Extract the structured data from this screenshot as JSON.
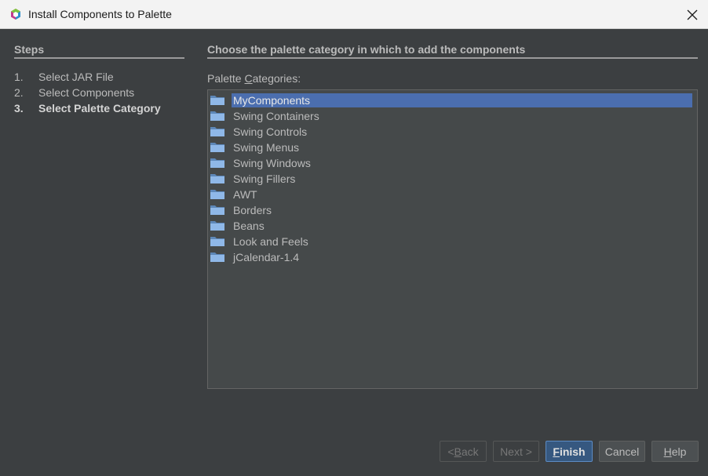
{
  "window": {
    "title": "Install Components to Palette",
    "close_icon": "close-icon",
    "app_icon": "netbeans-icon"
  },
  "steps": {
    "heading": "Steps",
    "items": [
      {
        "num": "1.",
        "label": "Select JAR File"
      },
      {
        "num": "2.",
        "label": "Select Components"
      },
      {
        "num": "3.",
        "label": "Select Palette Category",
        "current": true
      }
    ]
  },
  "main": {
    "heading": "Choose the palette category in which to add the components",
    "list_label_pre": "Palette ",
    "list_label_mnemonic": "C",
    "list_label_post": "ategories:",
    "categories": [
      {
        "label": "MyComponents",
        "selected": true
      },
      {
        "label": "Swing Containers"
      },
      {
        "label": "Swing Controls"
      },
      {
        "label": "Swing Menus"
      },
      {
        "label": "Swing Windows"
      },
      {
        "label": "Swing Fillers"
      },
      {
        "label": "AWT"
      },
      {
        "label": "Borders"
      },
      {
        "label": "Beans"
      },
      {
        "label": "Look and Feels"
      },
      {
        "label": "jCalendar-1.4"
      }
    ]
  },
  "buttons": {
    "back_pre": "< ",
    "back_mn": "B",
    "back_post": "ack",
    "next": "Next >",
    "finish_mn": "F",
    "finish_post": "inish",
    "cancel": "Cancel",
    "help_mn": "H",
    "help_post": "elp"
  },
  "colors": {
    "background": "#3c3f41",
    "selection": "#4b6eaf",
    "default_button": "#365880",
    "folder": "#8fb8e8"
  }
}
